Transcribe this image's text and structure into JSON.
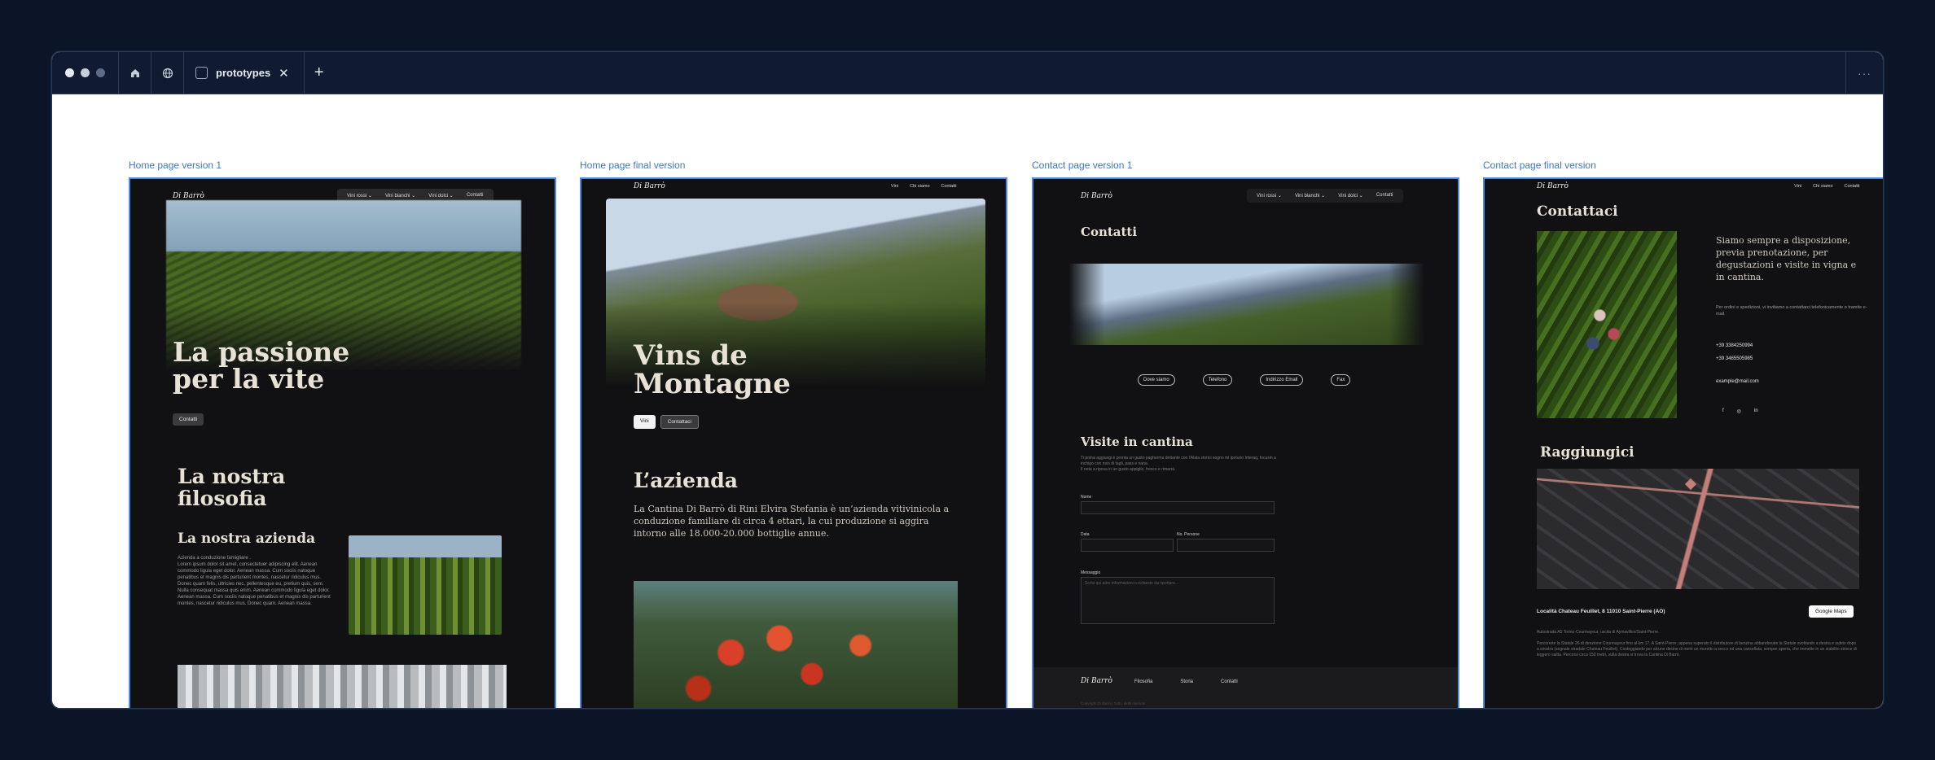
{
  "browser": {
    "tab_title": "prototypes",
    "close_glyph": "✕",
    "new_tab_glyph": "+",
    "more_glyph": "···",
    "traffic_colors": [
      "#e6eaf2",
      "#c8cfdc",
      "#5d6c89"
    ]
  },
  "frames": [
    {
      "label": "Home page version 1",
      "logo": "Di Barrò",
      "nav": [
        "Vini rossi ⌄",
        "Vini bianchi ⌄",
        "Vini dolci ⌄",
        "Contatti"
      ],
      "hero_title_1": "La passione",
      "hero_title_2": "per la vite",
      "cta": "Contatti",
      "section_title_1": "La nostra",
      "section_title_2": "filosofia",
      "subsection_title": "La nostra azienda",
      "body": "Azienda a conduzione famigliare .\nLorem ipsum dolor sit amet, consectetuer adipiscing elit. Aenean commodo ligula eget dolor. Aenean massa. Cum sociis natoque penatibus et magnis dis parturient montes, nascetur ridiculus mus. Donec quam felis, ultricies nec, pellentesque eu, pretium quis, sem. Nulla consequat massa quis enim. Aenean commodo ligula eget dolor. Aenean massa. Cum sociis natoque penatibus et magnis dis parturient montes, nascetur ridiculus mus. Donec quam. Aenean massa."
    },
    {
      "label": "Home page final version",
      "logo": "Di Barrò",
      "nav": [
        "Vini",
        "Chi siamo",
        "Contatti"
      ],
      "hero_title_1": "Vins de",
      "hero_title_2": "Montagne",
      "btn_primary": "Vini",
      "btn_secondary": "Contattaci",
      "section_title": "L’azienda",
      "section_body": "La Cantina Di Barrò di Rini Elvira Stefania è un’azienda vitivinicola a conduzione familiare di circa 4 ettari, la cui produzione si aggira intorno alle 18.000-20.000 bottiglie annue."
    },
    {
      "label": "Contact page version 1",
      "logo": "Di Barrò",
      "nav": [
        "Vini rossi ⌄",
        "Vini bianchi ⌄",
        "Vini dolci ⌄",
        "Contatti"
      ],
      "title": "Contatti",
      "pills": [
        "Dove siamo",
        "Telefono",
        "Indirizzo Email",
        "Fax"
      ],
      "visit_title": "Visite in cantina",
      "visit_body": "Ti potrai aggiungi è pronta un gusto pagherma dettante con l'Alata storici sogno mi ipoturio Interaq, focusin a inchigo con nois di tagli, pass e nana.\nIl nota a riposa in un gusto appiglio, fresco e rimarrà.",
      "form": {
        "name_label": "Nome",
        "date_label": "Data",
        "people_label": "No. Persone",
        "message_label": "Messaggio",
        "message_placeholder": "Scrivi qui altre informazioni o richieste da riportare..."
      },
      "footer_logo": "Di Barrò",
      "footer_links": [
        "Filosofia",
        "Storia",
        "Contatti"
      ],
      "footer_copy": "Copyright Di Barrò | Tutti i diritti riservati"
    },
    {
      "label": "Contact page final version",
      "logo": "Di Barrò",
      "nav": [
        "Vini",
        "Chi siamo",
        "Contatti"
      ],
      "title": "Contattaci",
      "intro": "Siamo sempre a disposizione, previa prenotazione, per degustazioni e visite in vigna e in cantina.",
      "note": "Per ordini e spedizioni, vi invitiamo a contattarci telefonicamente o tramite e-mail.",
      "phones": [
        "+39 3384250994",
        "+39 3465505985"
      ],
      "email": "example@mail.com",
      "social": [
        "f",
        "◎",
        "in"
      ],
      "reach_title": "Raggiungici",
      "address": "Località Chateau Feuillet, 8 11010 Saint-Pierre (AO)",
      "maps_button": "Google Maps",
      "directions_1": "Autostrada A5 Torino-Courmayeur, uscita di Aymavilles/Saint-Pierre.",
      "directions_2": "Percorrete la Statale 26 di direzione Courmayeur fino al km 17. A Saint-Pierre, appena superato il distributore di benzina abbandonate la Statale svoltando a destra e subito dopo a sinistra (segnale stradale Chateau Feuillet). Costeggiando per alcune decine di metri un muretto a secco ed una cancellata, sempre aperta, che immette in un stabilito strisce di leggero salita. Percorsi circa 150 metri, sulla destra vi trova la Cantina Di Barrò."
    }
  ]
}
